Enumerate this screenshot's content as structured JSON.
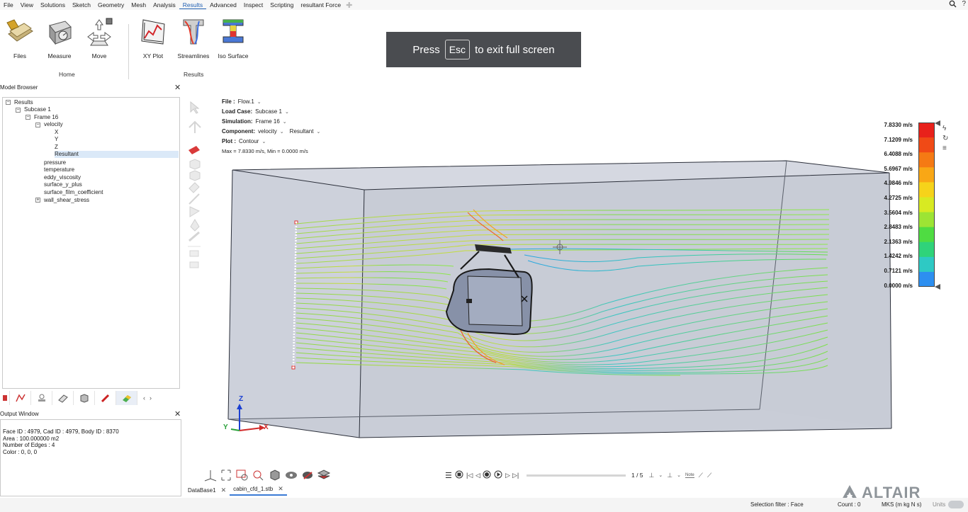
{
  "menu": {
    "items": [
      "File",
      "View",
      "Solutions",
      "Sketch",
      "Geometry",
      "Mesh",
      "Analysis",
      "Results",
      "Advanced",
      "Inspect",
      "Scripting",
      "resultant Force"
    ],
    "active": "Results"
  },
  "ribbon": {
    "tools": {
      "files": "Files",
      "measure": "Measure",
      "move": "Move",
      "xy_plot": "XY Plot",
      "streamlines": "Streamlines",
      "iso_surface": "Iso Surface"
    },
    "groups": {
      "home": "Home",
      "results": "Results"
    }
  },
  "toast": {
    "before": "Press",
    "key": "Esc",
    "after": "to exit full screen"
  },
  "model_browser": {
    "title": "Model Browser",
    "tree": {
      "results": "Results",
      "subcase": "Subcase 1",
      "frame": "Frame 16",
      "velocity": "velocity",
      "x": "X",
      "y": "Y",
      "z": "Z",
      "resultant": "Resultant",
      "pressure": "pressure",
      "temperature": "temperature",
      "eddy_viscosity": "eddy_viscosity",
      "surface_y_plus": "surface_y_plus",
      "surface_film_coefficient": "surface_film_coefficient",
      "wall_shear_stress": "wall_shear_stress"
    }
  },
  "output_window": {
    "title": "Output Window",
    "lines": [
      "Face ID : 4979, Cad ID : 4979, Body ID : 8370",
      "Area : 100.000000 m2",
      "Number of Edges : 4",
      "Color : 0, 0, 0"
    ]
  },
  "info_panel": {
    "file_label": "File :",
    "file_value": "Flow.1",
    "loadcase_label": "Load Case:",
    "loadcase_value": "Subcase 1",
    "simulation_label": "Simulation:",
    "simulation_value": "Frame 16",
    "component_label": "Component:",
    "component_value": "velocity",
    "component_sub": "Resultant",
    "plot_label": "Plot :",
    "plot_value": "Contour",
    "range_text": "Max = 7.8330 m/s, Min = 0.0000 m/s"
  },
  "legend": {
    "labels": [
      "7.8330 m/s",
      "7.1209 m/s",
      "6.4088 m/s",
      "5.6967 m/s",
      "4.9846 m/s",
      "4.2725 m/s",
      "3.5604 m/s",
      "2.8483 m/s",
      "2.1363 m/s",
      "1.4242 m/s",
      "0.7121 m/s",
      "0.0000 m/s"
    ],
    "colors": [
      "#e8211b",
      "#f04a16",
      "#f57a14",
      "#f9a715",
      "#f6d31a",
      "#d8ea22",
      "#9de434",
      "#4fdc42",
      "#2fd37a",
      "#2ec9c4",
      "#2d8ff0",
      "#2340f0"
    ]
  },
  "axes": {
    "z": "Z",
    "y": "Y",
    "x": "X"
  },
  "playback": {
    "frame": "1 / 5",
    "note": "Note"
  },
  "doc_tabs": [
    "DataBase1",
    "cabin_cfd_1.stb"
  ],
  "status": {
    "selection_filter": "Selection filter : Face",
    "count": "Count : 0",
    "units_system": "MKS (m kg N s)",
    "units_label": "Units"
  },
  "brand": {
    "name": "ALTAIR"
  }
}
